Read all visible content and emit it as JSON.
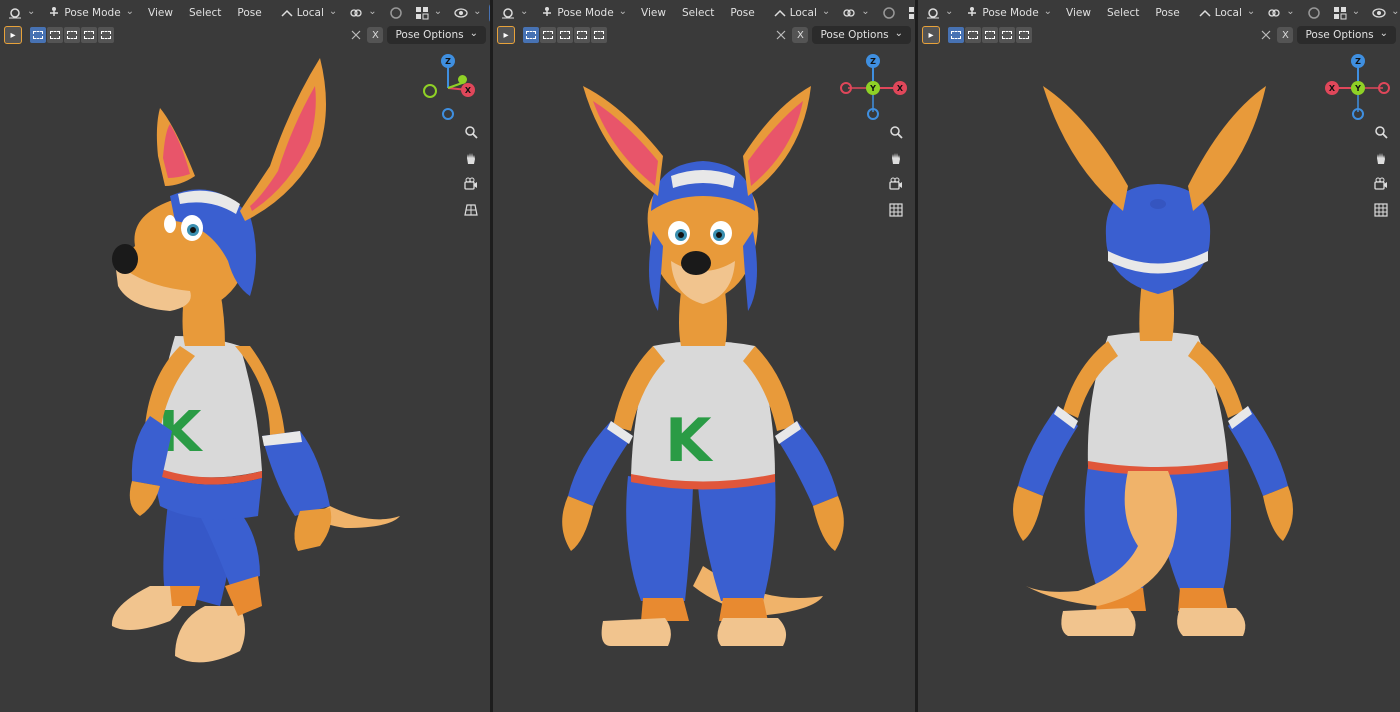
{
  "viewports": [
    {
      "id": "left",
      "mode_label": "Pose Mode",
      "menus": [
        "View",
        "Select",
        "Pose"
      ],
      "transform_orientation": "Local",
      "pose_options_label": "Pose Options",
      "close_label": "X",
      "gizmo": {
        "axes": [
          "Z",
          "X"
        ]
      }
    },
    {
      "id": "front",
      "mode_label": "Pose Mode",
      "menus": [
        "View",
        "Select",
        "Pose"
      ],
      "transform_orientation": "Local",
      "pose_options_label": "Pose Options",
      "close_label": "X",
      "gizmo": {
        "axes": [
          "Z",
          "Y",
          "X"
        ]
      }
    },
    {
      "id": "back",
      "mode_label": "Pose Mode",
      "menus": [
        "View",
        "Select",
        "Pose"
      ],
      "transform_orientation": "Local",
      "pose_options_label": "Pose Options",
      "close_label": "X",
      "gizmo": {
        "axes": [
          "Z",
          "Y",
          "X"
        ]
      }
    }
  ],
  "character": {
    "shirt_letter": "K"
  },
  "colors": {
    "background": "#3a3a3a",
    "header": "#2b2b2b",
    "accent": "#4772b3",
    "axis_x": "#e0475a",
    "axis_y": "#8fd126",
    "axis_z": "#3f8fe0",
    "fur": "#e89a3a",
    "shirt": "#d9d9d9",
    "pants": "#3a5fd0",
    "letter": "#2a9b45"
  },
  "icons": [
    "editor-type-icon",
    "pose-mode-icon",
    "orientation-icon",
    "link-icon",
    "proportional-icon",
    "snap-icon",
    "visibility-icon",
    "gizmo-icon",
    "overlay-icon",
    "shading-icon",
    "zoom-icon",
    "hand-icon",
    "camera-icon",
    "grid-icon"
  ]
}
